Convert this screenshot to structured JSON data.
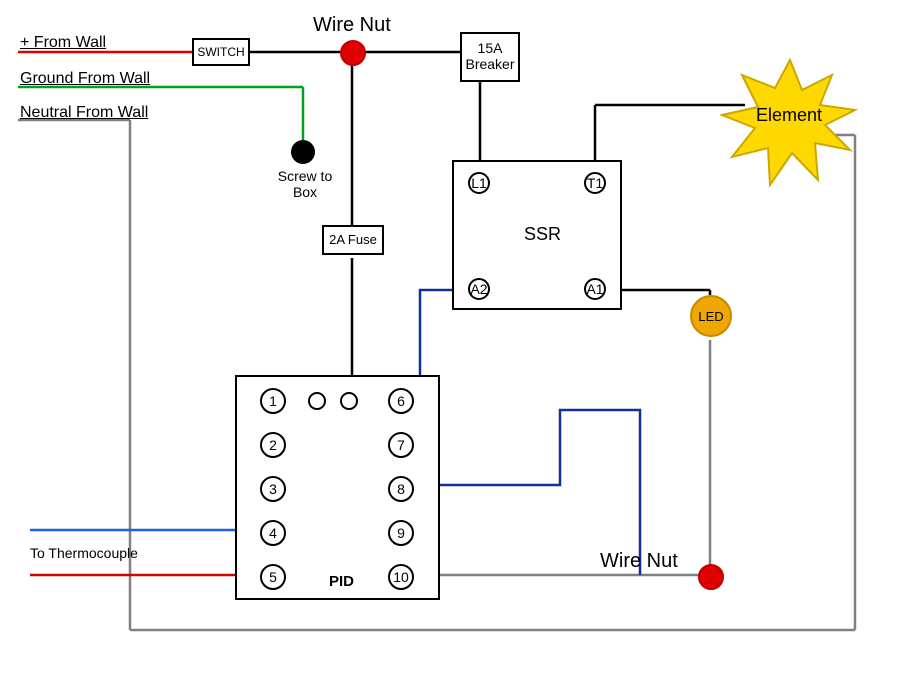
{
  "title_top": "Wire Nut",
  "title_bottom": "Wire Nut",
  "wall": {
    "positive": "+ From Wall",
    "ground": "Ground  From Wall",
    "neutral": "Neutral From Wall"
  },
  "switch_label": "SWITCH",
  "screw_label": "Screw to\nBox",
  "breaker_label": "15A\nBreaker",
  "fuse_label": "2A Fuse",
  "ssr": {
    "label": "SSR",
    "L1": "L1",
    "T1": "T1",
    "A1": "A1",
    "A2": "A2"
  },
  "element_label": "Element",
  "led_label": "LED",
  "thermocouple_label": "To Thermocouple",
  "pid": {
    "label": "PID",
    "pins": [
      "1",
      "2",
      "3",
      "4",
      "5",
      "6",
      "7",
      "8",
      "9",
      "10"
    ]
  },
  "colors": {
    "red": "#e00000",
    "green": "#00a020",
    "blue": "#1030a0",
    "gray": "#808080",
    "black": "#000000",
    "orange": "#f0a800",
    "yellow": "#ffd800",
    "darkred": "#c00000"
  }
}
